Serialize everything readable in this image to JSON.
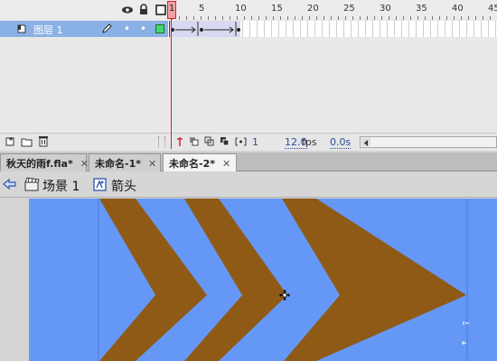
{
  "timeline": {
    "frame_numbers": [
      "1",
      "5",
      "10",
      "15",
      "20",
      "25",
      "30",
      "35",
      "40",
      "45"
    ],
    "current_frame": "1",
    "frame_rate": "12.0",
    "fps_unit": "fps",
    "elapsed_time": "0.0s",
    "layer": {
      "name": "图层 1"
    }
  },
  "tabs": [
    {
      "label": "秋天的雨f.fla*",
      "close": "✕"
    },
    {
      "label": "未命名-1*",
      "close": "✕"
    },
    {
      "label": "未命名-2*",
      "close": "✕"
    }
  ],
  "breadcrumb": {
    "scene": "场景 1",
    "symbol": "箭头"
  },
  "icons": {
    "eye": "eye-icon",
    "lock": "lock-icon",
    "outline": "outline-icon",
    "back": "back-arrow-icon",
    "scene": "scene-clapper-icon",
    "symbol": "symbol-icon"
  },
  "colors": {
    "stage_background": "#6598f6",
    "arrow_fill": "#8f5a16",
    "layer_selected": "#8ab1e6",
    "playhead": "#d9222a"
  }
}
